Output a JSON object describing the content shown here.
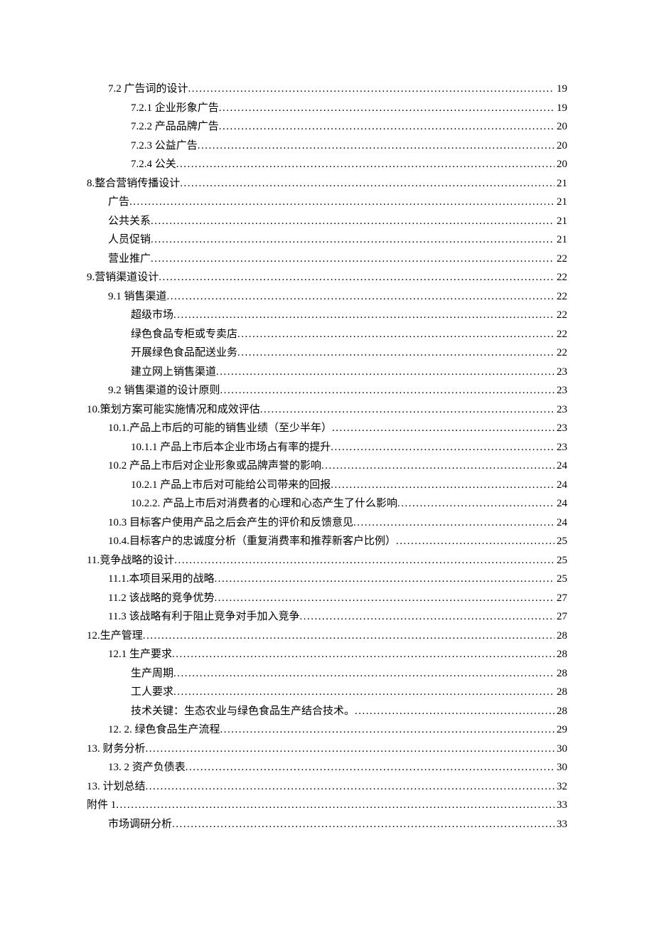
{
  "toc": [
    {
      "indent": 1,
      "label": "7.2 广告词的设计",
      "page": "19"
    },
    {
      "indent": 2,
      "label": "7.2.1 企业形象广告",
      "page": "19"
    },
    {
      "indent": 2,
      "label": "7.2.2 产品品牌广告",
      "page": "20"
    },
    {
      "indent": 2,
      "label": "7.2.3 公益广告",
      "page": "20"
    },
    {
      "indent": 2,
      "label": "7.2.4 公关",
      "page": "20"
    },
    {
      "indent": 0,
      "label": "8.整合营销传播设计",
      "page": "21"
    },
    {
      "indent": 1,
      "label": "广告",
      "page": "21"
    },
    {
      "indent": 1,
      "label": "公共关系",
      "page": "21"
    },
    {
      "indent": 1,
      "label": "人员促销",
      "page": "21"
    },
    {
      "indent": 1,
      "label": "营业推广",
      "page": "22"
    },
    {
      "indent": 0,
      "label": "9.营销渠道设计",
      "page": "22"
    },
    {
      "indent": 1,
      "label": "9.1 销售渠道",
      "page": "22"
    },
    {
      "indent": 2,
      "label": "超级市场",
      "page": "22"
    },
    {
      "indent": 2,
      "label": "绿色食品专柜或专卖店",
      "page": "22"
    },
    {
      "indent": 2,
      "label": "开展绿色食品配送业务",
      "page": "22"
    },
    {
      "indent": 2,
      "label": "建立网上销售渠道",
      "page": "23"
    },
    {
      "indent": 1,
      "label": "9.2 销售渠道的设计原则",
      "page": "23"
    },
    {
      "indent": 0,
      "label": "10.策划方案可能实施情况和成效评估",
      "page": "23"
    },
    {
      "indent": 1,
      "label": "10.1.产品上市后的可能的销售业绩（至少半年）",
      "page": "23"
    },
    {
      "indent": 2,
      "label": "10.1.1 产品上市后本企业市场占有率的提升",
      "page": "23"
    },
    {
      "indent": 1,
      "label": "10.2 产品上市后对企业形象或品牌声誉的影响",
      "page": "24"
    },
    {
      "indent": 2,
      "label": "10.2.1 产品上市后对可能给公司带来的回报",
      "page": "24"
    },
    {
      "indent": 2,
      "label": "10.2.2.  产品上市后对消费者的心理和心态产生了什么影响",
      "page": "24"
    },
    {
      "indent": 1,
      "label": "10.3 目标客户使用产品之后会产生的评价和反馈意见",
      "page": "24"
    },
    {
      "indent": 1,
      "label": "10.4.目标客户的忠诚度分析（重复消费率和推荐新客户比例）",
      "page": "25"
    },
    {
      "indent": 0,
      "label": "11.竞争战略的设计",
      "page": "25"
    },
    {
      "indent": 1,
      "label": "11.1.本项目采用的战略",
      "page": "25"
    },
    {
      "indent": 1,
      "label": "11.2 该战略的竞争优势",
      "page": "27"
    },
    {
      "indent": 1,
      "label": "11.3 该战略有利于阻止竞争对手加入竞争",
      "page": "27"
    },
    {
      "indent": 0,
      "label": "12.生产管理",
      "page": "28"
    },
    {
      "indent": 1,
      "label": "12.1 生产要求",
      "page": "28"
    },
    {
      "indent": 2,
      "label": "生产周期",
      "page": "28"
    },
    {
      "indent": 2,
      "label": "工人要求",
      "page": "28"
    },
    {
      "indent": 2,
      "label": "技术关键：生态农业与绿色食品生产结合技术。",
      "page": "28"
    },
    {
      "indent": 1,
      "label": "12. 2. 绿色食品生产流程",
      "page": "29"
    },
    {
      "indent": 0,
      "label": "13. 财务分析",
      "page": "30"
    },
    {
      "indent": 1,
      "label": "13. 2 资产负债表",
      "page": "30"
    },
    {
      "indent": 0,
      "label": "13. 计划总结",
      "page": "32"
    },
    {
      "indent": 0,
      "label": "附件 1",
      "page": "33"
    },
    {
      "indent": 1,
      "label": "市场调研分析",
      "page": "33"
    }
  ]
}
